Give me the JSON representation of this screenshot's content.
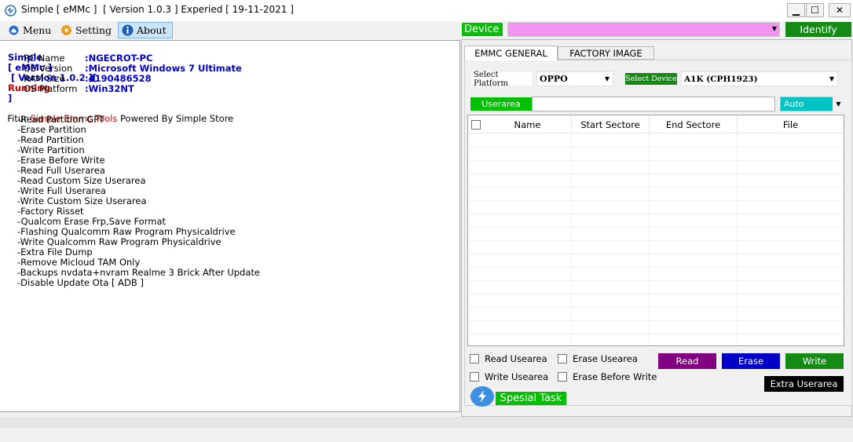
{
  "window": {
    "title": "Simple [ eMMc ]  [ Version 1.0.3 ] Experied [ 19-11-2021 ]",
    "minimize": "▁",
    "maximize": "☐",
    "close": "✕"
  },
  "menubar": {
    "items": [
      {
        "label": "Menu",
        "icon": "home-icon"
      },
      {
        "label": "Setting",
        "icon": "gear-icon"
      },
      {
        "label": "About",
        "icon": "info-icon"
      }
    ]
  },
  "info": {
    "header_simple": "Simple",
    "header_emmc": "[ eMMc ]",
    "header_version": "[ Version 1.0.2 ][",
    "header_running": "Running",
    "header_close": "]",
    "rows": [
      {
        "label": "PC Name",
        "value": ":NGECROT-PC"
      },
      {
        "label": "OS Version",
        "value": ":Microsoft Windows 7 Ultimate"
      },
      {
        "label": "RAM Size",
        "value": ":4190486528"
      },
      {
        "label": "OS Platform",
        "value": ":Win32NT"
      }
    ],
    "fitur_prefix": "Fitur ",
    "fitur_highlight": "Simple Emmc Tools",
    "fitur_suffix": " Powered By Simple Store",
    "features": [
      "-Read Partition GPT",
      "-Erase Partition",
      "-Read Partition",
      "-Write Partition",
      "-Erase Before Write",
      "-Read Full Userarea",
      "-Read Custom Size Userarea",
      "-Write Full Userarea",
      "-Write Custom Size Userarea",
      "-Factory Risset",
      "-Qualcom Erase Frp,Save Format",
      "-Flashing Qualcomm Raw Program Physicaldrive",
      "-Write Qualcomm Raw Program Physicaldrive",
      "-Extra File Dump",
      "-Remove Micloud TAM Only",
      "-Backups nvdata+nvram Realme 3 Brick After Update",
      "-Disable Update Ota [ ADB ]"
    ]
  },
  "device": {
    "label": "Device",
    "value": "",
    "identify": "Identify"
  },
  "tabs": [
    {
      "label": "EMMC GENERAL",
      "active": true
    },
    {
      "label": "FACTORY IMAGE",
      "active": false
    }
  ],
  "platform": {
    "label": "Select Platform",
    "value": "OPPO",
    "device_label": "Select Device",
    "device_value": "A1K (CPH1923)"
  },
  "userarea": {
    "label": "Userarea",
    "value": "",
    "mode": "Auto"
  },
  "grid": {
    "columns": [
      "Name",
      "Start Sectore",
      "End Sectore",
      "File"
    ],
    "rows": []
  },
  "options": {
    "read_userarea": "Read Usearea",
    "erase_userarea": "Erase Usearea",
    "write_userarea": "Write Usearea",
    "erase_before_write": "Erase Before Write"
  },
  "actions": {
    "read": "Read",
    "erase": "Erase",
    "write": "Write",
    "extra": "Extra Userarea",
    "spesial": "Spesial Task"
  },
  "colors": {
    "green": "#00c000",
    "dark_green": "#148a14",
    "pink": "#f593f0",
    "cyan": "#00c4c4",
    "purple": "#800080",
    "blue": "#0000c8",
    "running_red": "#cc0000"
  }
}
